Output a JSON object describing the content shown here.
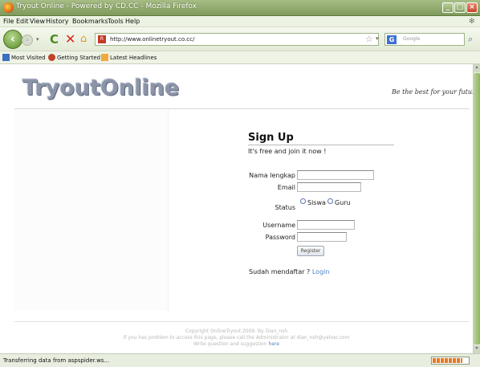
{
  "window": {
    "title": "Tryout Online - Powered by CD.CC - Mozilla Firefox"
  },
  "menu": {
    "items": [
      "File",
      "Edit",
      "View",
      "History",
      "Bookmarks",
      "Tools",
      "Help"
    ]
  },
  "nav": {
    "url": "http://www.onlinetryout.co.cc/",
    "search_placeholder": "Google"
  },
  "bookmarks": {
    "items": [
      "Most Visited",
      "Getting Started",
      "Latest Headlines"
    ]
  },
  "page": {
    "logo": "TryoutOnline",
    "slogan": "Be the best for your future",
    "signup": {
      "title": "Sign Up",
      "subtitle": "It's free and join it now !",
      "labels": {
        "nama": "Nama lengkap",
        "email": "Email",
        "status": "Status",
        "username": "Username",
        "password": "Password"
      },
      "status_options": [
        "Siswa",
        "Guru"
      ],
      "register_label": "Register",
      "already_text": "Sudah mendaftar ?",
      "login_link": "Login"
    },
    "footer": {
      "line1": "Copyright OnlineTryout 2009. By Dian_nsh",
      "line2": "If you has problem to access this page, please call the Administrator at dian_nsh@yahoo.com",
      "line3_text": "Write question and suggestion",
      "line3_link": "here"
    }
  },
  "status": {
    "text": "Transferring data from aspspider.ws...",
    "progress": 0.85
  }
}
